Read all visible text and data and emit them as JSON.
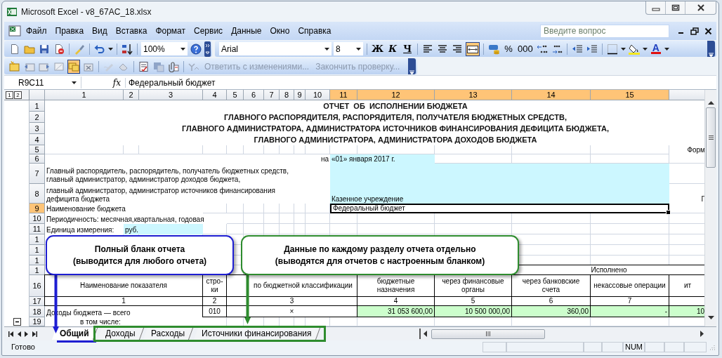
{
  "window": {
    "title": "Microsoft Excel - v8_67AC_18.xlsx"
  },
  "menu": [
    "Файл",
    "Правка",
    "Вид",
    "Вставка",
    "Формат",
    "Сервис",
    "Данные",
    "Окно",
    "Справка"
  ],
  "help_search": {
    "placeholder": "Введите вопрос"
  },
  "standard_toolbar": {
    "zoom": "100%"
  },
  "format_toolbar": {
    "font": "Arial",
    "size": "8",
    "bold": "Ж",
    "italic": "К",
    "underline": "Ч",
    "percent": "%",
    "thousands": "000",
    "font_color": "A",
    "merge_on": true
  },
  "review_toolbar": {
    "edit_on": true,
    "commands": [
      {
        "label": "Ответить с изменениями...",
        "disabled": true
      },
      {
        "label": "Закончить проверку...",
        "disabled": true
      }
    ]
  },
  "formula_bar": {
    "name_box": "R9C11",
    "function_label": "fx",
    "formula": "Федеральный бюджет"
  },
  "outline_levels": [
    "1",
    "2"
  ],
  "columns": [
    {
      "label": "1",
      "selected": false
    },
    {
      "label": "2",
      "selected": false
    },
    {
      "label": "3",
      "selected": false
    },
    {
      "label": "4",
      "selected": false
    },
    {
      "label": "5",
      "selected": false
    },
    {
      "label": "6",
      "selected": false
    },
    {
      "label": "7",
      "selected": false
    },
    {
      "label": "8",
      "selected": false
    },
    {
      "label": "9",
      "selected": false
    },
    {
      "label": "10",
      "selected": false
    },
    {
      "label": "11",
      "selected": true
    },
    {
      "label": "12",
      "selected": true
    },
    {
      "label": "13",
      "selected": true
    },
    {
      "label": "14",
      "selected": true
    },
    {
      "label": "15",
      "selected": true
    },
    {
      "selected": false
    }
  ],
  "rows": [
    {
      "label": "1",
      "selected": false
    },
    {
      "label": "2",
      "selected": false
    },
    {
      "label": "3",
      "selected": false
    },
    {
      "label": "4",
      "selected": false
    },
    {
      "label": "5",
      "selected": false
    },
    {
      "label": "6",
      "selected": false
    },
    {
      "label": "7",
      "selected": false
    },
    {
      "label": "8",
      "selected": false
    },
    {
      "label": "9",
      "selected": true
    },
    {
      "label": "10",
      "selected": false
    },
    {
      "label": "11",
      "selected": false
    },
    {
      "label": "1",
      "selected": false
    },
    {
      "label": "1",
      "selected": false
    },
    {
      "label": "1",
      "selected": false
    },
    {
      "label": "1",
      "selected": false
    },
    {
      "label": "16",
      "selected": false
    },
    {
      "label": "17",
      "selected": false
    },
    {
      "label": "18",
      "selected": false
    },
    {
      "label": "19",
      "selected": false,
      "collapsible": true
    }
  ],
  "cells": [
    {
      "kind": "title",
      "text": "ОТЧЕТ  ОБ  ИСПОЛНЕНИИ БЮДЖЕТА"
    },
    {
      "kind": "title",
      "text": "ГЛАВНОГО РАСПОРЯДИТЕЛЯ, РАСПОРЯДИТЕЛЯ, ПОЛУЧАТЕЛЯ БЮДЖЕТНЫХ СРЕДСТВ,"
    },
    {
      "kind": "title",
      "text": "ГЛАВНОГО АДМИНИСТРАТОРА, АДМИНИСТРАТОРА ИСТОЧНИКОВ ФИНАНСИРОВАНИЯ ДЕФИЦИТА БЮДЖЕТА,"
    },
    {
      "kind": "title",
      "text": "ГЛАВНОГО АДМИНИСТРАТОРА, АДМИНИСТРАТОРА ДОХОДОВ БЮДЖЕТА"
    },
    {
      "kind": "right",
      "text": "Форм"
    },
    {
      "kind": "right",
      "text": "на"
    },
    {
      "kind": "input",
      "text": "«01» января 2017 г."
    },
    {
      "kind": "text",
      "text": "Главный распорядитель, распорядитель, получатель бюджетных средств,\nглавный администратор, администратор доходов бюджета,"
    },
    {
      "kind": "text",
      "text": "главный администратор, администратор источников финансирования\nдефицита бюджета"
    },
    {
      "kind": "input",
      "text": "Казенное учреждение"
    },
    {
      "kind": "right",
      "text": "Г"
    },
    {
      "kind": "text",
      "text": "Наименование бюджета"
    },
    {
      "kind": "active",
      "text": "Федеральный бюджет"
    },
    {
      "kind": "text",
      "text": "Периодичность: месячная,квартальная, годовая"
    },
    {
      "kind": "text",
      "text": "Единица измерения:"
    },
    {
      "kind": "input",
      "text": "руб."
    },
    {
      "kind": "head",
      "text": "Исполнено"
    },
    {
      "kind": "head",
      "text": "Наименование показателя"
    },
    {
      "kind": "head",
      "text": "стро-ки"
    },
    {
      "kind": "head",
      "text": "по бюджетной классификации"
    },
    {
      "kind": "head",
      "text": "бюджетные назначения"
    },
    {
      "kind": "head",
      "text": "через финансовые органы"
    },
    {
      "kind": "head",
      "text": "через банковские счета"
    },
    {
      "kind": "head",
      "text": "некассовые операции"
    },
    {
      "kind": "head",
      "text": "ит"
    },
    {
      "kind": "head",
      "text": "1"
    },
    {
      "kind": "head",
      "text": "2"
    },
    {
      "kind": "head",
      "text": "3"
    },
    {
      "kind": "head",
      "text": "4"
    },
    {
      "kind": "head",
      "text": "5"
    },
    {
      "kind": "head",
      "text": "6"
    },
    {
      "kind": "head",
      "text": "7"
    },
    {
      "kind": "text",
      "text": "Доходы бюджета — всего"
    },
    {
      "kind": "head",
      "text": "010"
    },
    {
      "kind": "head",
      "text": "×"
    },
    {
      "kind": "total",
      "text": "31 053 600,00"
    },
    {
      "kind": "total",
      "text": "10 500 000,00"
    },
    {
      "kind": "total",
      "text": "360,00"
    },
    {
      "kind": "total",
      "text": "-"
    },
    {
      "kind": "total",
      "text": "10"
    },
    {
      "kind": "indent",
      "text": "в том числе:"
    }
  ],
  "callouts": [
    {
      "text": "Полный бланк отчета\n(выводится для любого отчета)",
      "color": "#1e1ed2"
    },
    {
      "text": "Данные по каждому разделу отчета отдельно\n(выводятся для отчетов с настроенным бланком)",
      "color": "#2e8c2e"
    }
  ],
  "sheet_tabs": [
    {
      "label": "Общий",
      "selected": true
    },
    {
      "label": "Доходы",
      "selected": false
    },
    {
      "label": "Расходы",
      "selected": false
    },
    {
      "label": "Источники финансирования",
      "selected": false
    }
  ],
  "status_bar": {
    "text": "Готово",
    "indicators": [
      "NUM"
    ]
  }
}
